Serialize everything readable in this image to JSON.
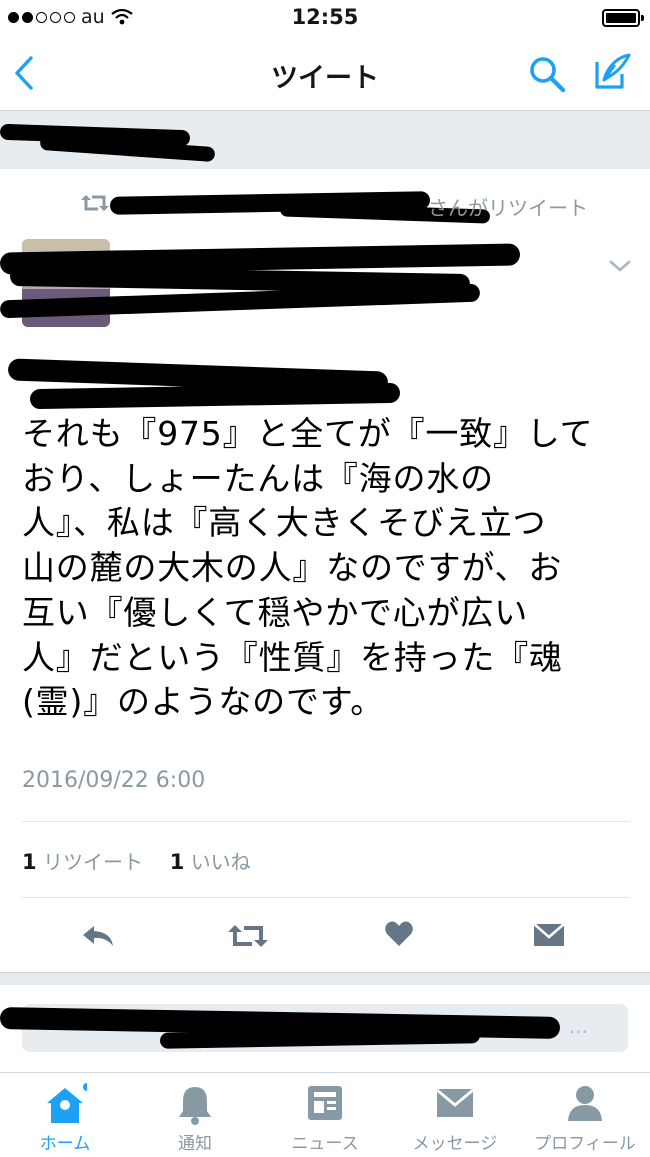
{
  "status": {
    "carrier": "au",
    "time": "12:55"
  },
  "nav": {
    "title": "ツイート"
  },
  "retweet_banner": {
    "label_suffix": "さんがリツイート"
  },
  "tweet": {
    "text": "それも『975』と全てが『一致』して\nおり、しょーたんは『海の水の\n人』、私は『高く大きくそびえ立つ\n山の麓の大木の人』なのですが、お\n互い『優しくて穏やかで心が広い\n人』だという『性質』を持った『魂\n(霊)』のようなのです。",
    "timestamp": "2016/09/22 6:00",
    "retweet_count": "1",
    "retweet_label": "リツイート",
    "like_count": "1",
    "like_label": "いいね"
  },
  "reply_box": {
    "placeholder_suffix": "…"
  },
  "tabs": [
    {
      "label": "ホーム",
      "icon": "home-icon",
      "active": true
    },
    {
      "label": "通知",
      "icon": "bell-icon"
    },
    {
      "label": "ニュース",
      "icon": "news-icon"
    },
    {
      "label": "メッセージ",
      "icon": "envelope-icon"
    },
    {
      "label": "プロフィール",
      "icon": "person-icon"
    }
  ],
  "colors": {
    "accent": "#1da1f2",
    "muted": "#8899a6",
    "icon_gray": "#657786"
  }
}
